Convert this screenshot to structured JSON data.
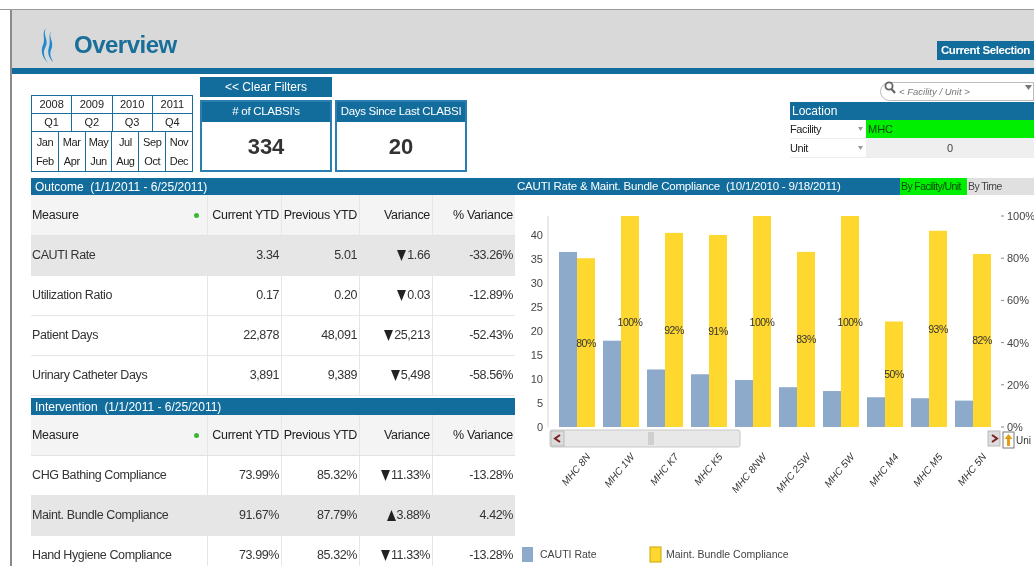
{
  "header": {
    "title": "Overview",
    "current_selection_button": "Current Selection"
  },
  "filters": {
    "clear_button": "<< Clear Filters",
    "calendar": {
      "years": [
        "2008",
        "2009",
        "2010",
        "2011"
      ],
      "quarters": [
        "Q1",
        "Q2",
        "Q3",
        "Q4"
      ],
      "months": [
        [
          "Jan",
          "Feb"
        ],
        [
          "Mar",
          "Apr"
        ],
        [
          "May",
          "Jun"
        ],
        [
          "Jul",
          "Aug"
        ],
        [
          "Sep",
          "Oct"
        ],
        [
          "Nov",
          "Dec"
        ]
      ]
    },
    "kpis": [
      {
        "label": "# of CLABSI's",
        "value": "334"
      },
      {
        "label": "Days Since Last CLABSI",
        "value": "20"
      }
    ],
    "search": {
      "placeholder": "< Facility / Unit >"
    },
    "location": {
      "title": "Location",
      "rows": [
        {
          "label": "Facility",
          "value": "MHC",
          "selected": true
        },
        {
          "label": "Unit",
          "value": "0",
          "selected": false
        }
      ]
    }
  },
  "tables": [
    {
      "title": "Outcome  (1/1/2011 - 6/25/2011)",
      "columns": [
        "Measure",
        "Current YTD",
        "Previous YTD",
        "Variance",
        "% Variance"
      ],
      "rows": [
        {
          "measure": "CAUTI Rate",
          "current": "3.34",
          "previous": "5.01",
          "kind": "down",
          "variance": "1.66",
          "pct": "-33.26%",
          "highlighted": true
        },
        {
          "measure": "Utilization Ratio",
          "current": "0.17",
          "previous": "0.20",
          "kind": "down",
          "variance": "0.03",
          "pct": "-12.89%",
          "highlighted": false
        },
        {
          "measure": "Patient Days",
          "current": "22,878",
          "previous": "48,091",
          "kind": "down",
          "variance": "25,213",
          "pct": "-52.43%",
          "highlighted": false
        },
        {
          "measure": "Urinary Catheter Days",
          "current": "3,891",
          "previous": "9,389",
          "kind": "down",
          "variance": "5,498",
          "pct": "-58.56%",
          "highlighted": false
        }
      ]
    },
    {
      "title": "Intervention  (1/1/2011 - 6/25/2011)",
      "columns": [
        "Measure",
        "Current YTD",
        "Previous YTD",
        "Variance",
        "% Variance"
      ],
      "rows": [
        {
          "measure": "CHG Bathing Compliance",
          "current": "73.99%",
          "previous": "85.32%",
          "kind": "down",
          "variance": "11.33%",
          "pct": "-13.28%",
          "highlighted": false
        },
        {
          "measure": "Maint. Bundle Compliance",
          "current": "91.67%",
          "previous": "87.79%",
          "kind": "up",
          "variance": "3.88%",
          "pct": "4.42%",
          "highlighted": true
        },
        {
          "measure": "Hand Hygiene Compliance",
          "current": "73.99%",
          "previous": "85.32%",
          "kind": "down",
          "variance": "11.33%",
          "pct": "-13.28%",
          "highlighted": false
        }
      ]
    }
  ],
  "chart_panel": {
    "view_tabs": [
      {
        "label": "By Facility/Unit",
        "selected": true
      },
      {
        "label": "By Time",
        "selected": false
      }
    ],
    "unit_label": "Uni",
    "chart_data": {
      "type": "bar",
      "title": "CAUTI Rate & Maint. Bundle Compliance  (10/1/2010 - 9/18/2011)",
      "categories": [
        "MHC 8N",
        "MHC 1W",
        "MHC K7",
        "MHC K5",
        "MHC 8NW",
        "MHC 2SW",
        "MHC 5W",
        "MHC M4",
        "MHC M5",
        "MHC 5N"
      ],
      "series": [
        {
          "name": "CAUTI Rate",
          "color": "#8eaacb",
          "values": [
            36.5,
            18,
            12,
            11,
            9.8,
            8.3,
            7.5,
            6.2,
            6,
            5.5
          ]
        }
      ],
      "ylim": [
        0,
        44
      ],
      "yticks": [
        0,
        5,
        10,
        15,
        20,
        25,
        30,
        35,
        40
      ],
      "legend": "bottom"
    },
    "compliance_chart": {
      "chart_data": {
        "type": "bar",
        "series": [
          {
            "name": "Maint. Bundle Compliance",
            "color": "#ffd82f",
            "values": [
              80,
              100,
              92,
              91,
              100,
              83,
              100,
              50,
              93,
              82
            ]
          }
        ],
        "ylim": [
          0,
          100
        ],
        "yticks": [
          {
            "value": 0,
            "label": "0%"
          },
          {
            "value": 20,
            "label": "20%"
          },
          {
            "value": 40,
            "label": "40%"
          },
          {
            "value": 60,
            "label": "60%"
          },
          {
            "value": 80,
            "label": "80%"
          },
          {
            "value": 100,
            "label": "100%"
          }
        ],
        "legend": "bottom",
        "value_labels": [
          "80%",
          "100%",
          "92%",
          "91%",
          "100%",
          "83%",
          "100%",
          "50%",
          "93%",
          "82%"
        ]
      }
    }
  }
}
